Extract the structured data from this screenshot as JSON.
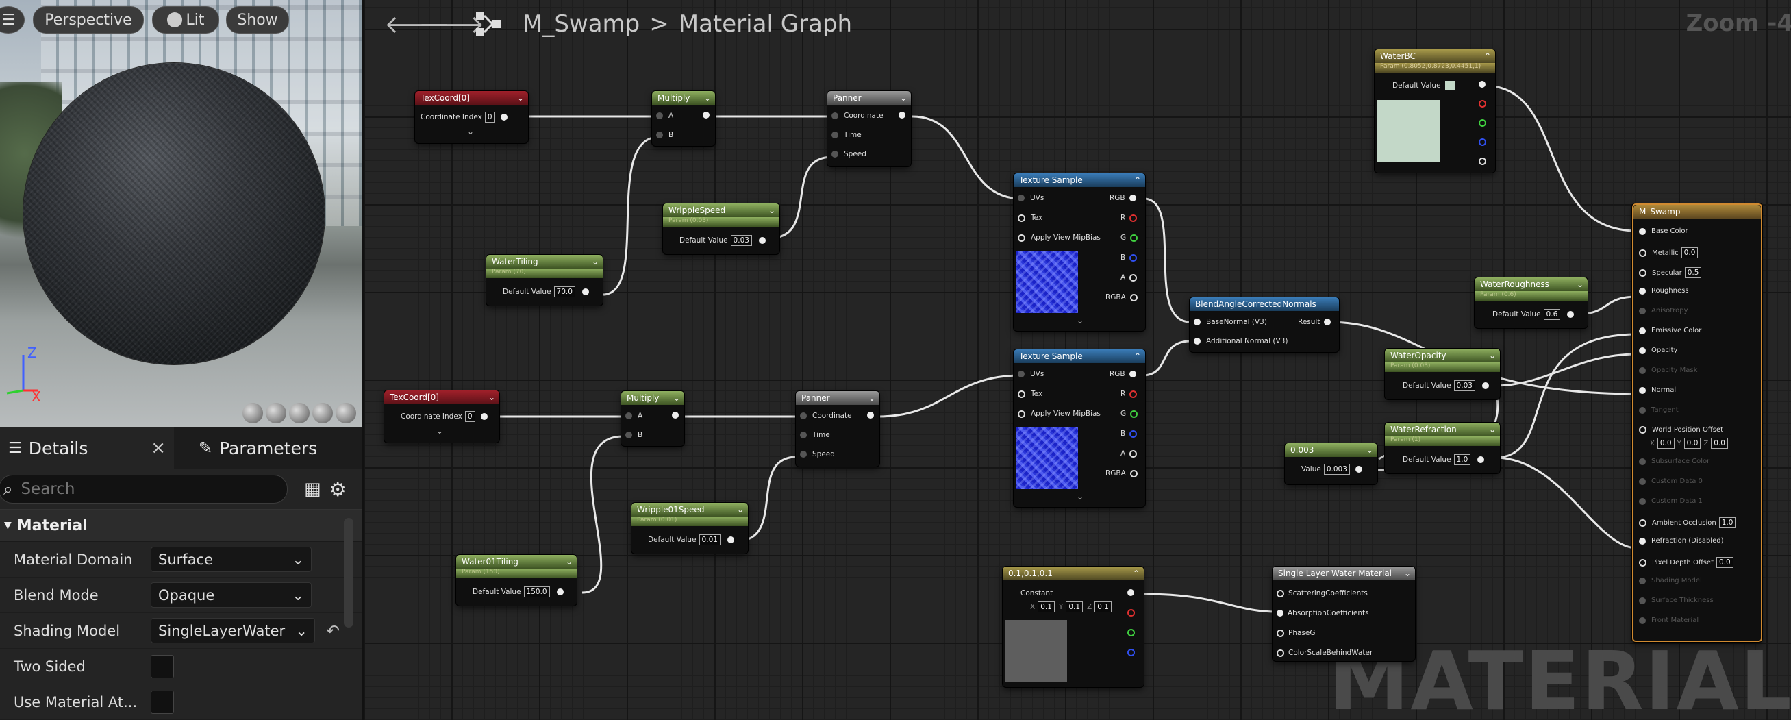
{
  "viewport": {
    "menu_icon": "hamburger-icon",
    "perspective_label": "Perspective",
    "lit_label": "Lit",
    "show_label": "Show",
    "axis_z": "Z",
    "axis_x": "X"
  },
  "details": {
    "tab_details": "Details",
    "tab_close": "×",
    "tab_parameters": "Parameters",
    "search_placeholder": "Search",
    "section_title": "Material",
    "rows": [
      {
        "label": "Material Domain",
        "value": "Surface"
      },
      {
        "label": "Blend Mode",
        "value": "Opaque"
      },
      {
        "label": "Shading Model",
        "value": "SingleLayerWater"
      },
      {
        "label": "Two Sided",
        "value": ""
      },
      {
        "label": "Use Material At...",
        "value": ""
      }
    ]
  },
  "graph": {
    "back": "🡐",
    "forward": "🡒",
    "asset": "M_Swamp",
    "separator": ">",
    "page": "Material Graph",
    "zoom": "Zoom -4",
    "watermark": "MATERIAL"
  },
  "nodes": {
    "texcoord1": {
      "title": "TexCoord[0]",
      "pin": "Coordinate Index",
      "value": "0"
    },
    "texcoord2": {
      "title": "TexCoord[0]",
      "pin": "Coordinate Index",
      "value": "0"
    },
    "multiply1": {
      "title": "Multiply",
      "a": "A",
      "b": "B"
    },
    "multiply2": {
      "title": "Multiply",
      "a": "A",
      "b": "B"
    },
    "panner1": {
      "title": "Panner",
      "coord": "Coordinate",
      "time": "Time",
      "speed": "Speed"
    },
    "panner2": {
      "title": "Panner",
      "coord": "Coordinate",
      "time": "Time",
      "speed": "Speed"
    },
    "wripplespeed": {
      "title": "WrippleSpeed",
      "sub": "Param (0.03)",
      "pin": "Default Value",
      "value": "0.03"
    },
    "wripple01speed": {
      "title": "Wripple01Speed",
      "sub": "Param (0.01)",
      "pin": "Default Value",
      "value": "0.01"
    },
    "watertiling": {
      "title": "WaterTiling",
      "sub": "Param (70)",
      "pin": "Default Value",
      "value": "70.0"
    },
    "water01tiling": {
      "title": "Water01Tiling",
      "sub": "Param (150)",
      "pin": "Default Value",
      "value": "150.0"
    },
    "texsample1": {
      "title": "Texture Sample",
      "uvs": "UVs",
      "tex": "Tex",
      "mip": "Apply View MipBias",
      "rgb": "RGB",
      "r": "R",
      "g": "G",
      "b": "B",
      "a": "A",
      "rgba": "RGBA"
    },
    "texsample2": {
      "title": "Texture Sample",
      "uvs": "UVs",
      "tex": "Tex",
      "mip": "Apply View MipBias",
      "rgb": "RGB",
      "r": "R",
      "g": "G",
      "b": "B",
      "a": "A",
      "rgba": "RGBA"
    },
    "blend": {
      "title": "BlendAngleCorrectedNormals",
      "base": "BaseNormal (V3)",
      "add": "Additional Normal (V3)",
      "result": "Result"
    },
    "waterbc": {
      "title": "WaterBC",
      "sub": "Param (0.8052,0.8723,0.4451,1)",
      "pin": "Default Value",
      "swatch": "#c3d8c8"
    },
    "waterroughness": {
      "title": "WaterRoughness",
      "sub": "Param (0.6)",
      "pin": "Default Value",
      "value": "0.6"
    },
    "wateropacity": {
      "title": "WaterOpacity",
      "sub": "Param (0.03)",
      "pin": "Default Value",
      "value": "0.03"
    },
    "waterrefraction": {
      "title": "WaterRefraction",
      "sub": "Param (1)",
      "pin": "Default Value",
      "value": "1.0"
    },
    "const003": {
      "title": "0.003",
      "pin": "Value",
      "value": "0.003"
    },
    "const3": {
      "title": "0.1,0.1,0.1",
      "pin": "Constant",
      "x": "0.1",
      "y": "0.1",
      "z": "0.1",
      "swatch": "#5e5e5e"
    },
    "slwm": {
      "title": "Single Layer Water Material",
      "pins": [
        "ScatteringCoefficients",
        "AbsorptionCoefficients",
        "PhaseG",
        "ColorScaleBehindWater"
      ]
    },
    "mswamp": {
      "title": "M_Swamp",
      "pins": [
        {
          "label": "Base Color",
          "value": "",
          "active": true
        },
        {
          "label": "Metallic",
          "value": "0.0",
          "active": true
        },
        {
          "label": "Specular",
          "value": "0.5",
          "active": true
        },
        {
          "label": "Roughness",
          "value": "",
          "active": true
        },
        {
          "label": "Anisotropy",
          "value": "",
          "active": false
        },
        {
          "label": "Emissive Color",
          "value": "",
          "active": true
        },
        {
          "label": "Opacity",
          "value": "",
          "active": true
        },
        {
          "label": "Opacity Mask",
          "value": "",
          "active": false
        },
        {
          "label": "Normal",
          "value": "",
          "active": true
        },
        {
          "label": "Tangent",
          "value": "",
          "active": false
        },
        {
          "label": "World Position Offset",
          "value": "",
          "active": true
        },
        {
          "label": "Subsurface Color",
          "value": "",
          "active": false
        },
        {
          "label": "Custom Data 0",
          "value": "",
          "active": false
        },
        {
          "label": "Custom Data 1",
          "value": "",
          "active": false
        },
        {
          "label": "Ambient Occlusion",
          "value": "1.0",
          "active": true
        },
        {
          "label": "Refraction (Disabled)",
          "value": "",
          "active": true
        },
        {
          "label": "Pixel Depth Offset",
          "value": "0.0",
          "active": true
        },
        {
          "label": "Shading Model",
          "value": "",
          "active": false
        },
        {
          "label": "Surface Thickness",
          "value": "",
          "active": false
        },
        {
          "label": "Front Material",
          "value": "",
          "active": false
        }
      ],
      "wpo_x": "0.0",
      "wpo_y": "0.0",
      "wpo_z": "0.0"
    }
  }
}
